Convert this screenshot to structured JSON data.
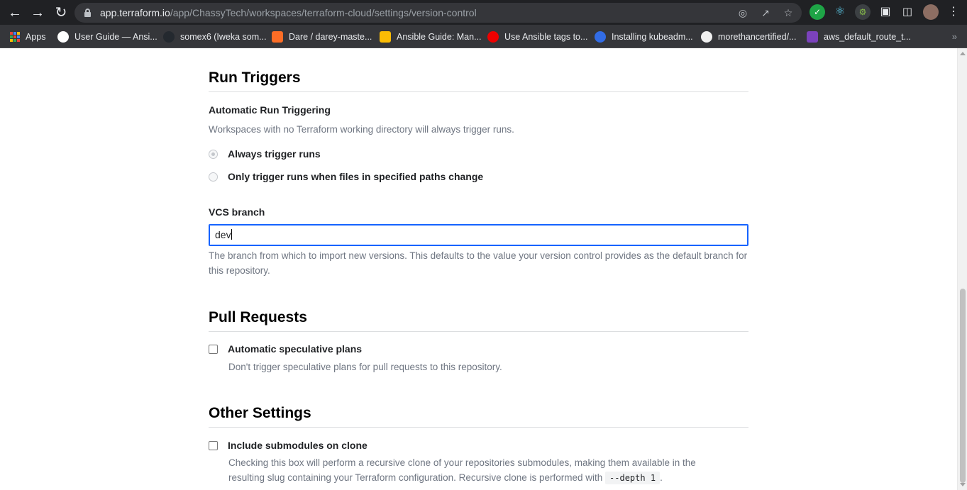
{
  "browser": {
    "url_host": "app.terraform.io",
    "url_path": "/app/ChassyTech/workspaces/terraform-cloud/settings/version-control",
    "bookmarks": [
      {
        "label": "Apps",
        "color": "#4285f4"
      },
      {
        "label": "User Guide — Ansi...",
        "color": "#ffffff"
      },
      {
        "label": "somex6 (Iweka som...",
        "color": "#24292f"
      },
      {
        "label": "Dare / darey-maste...",
        "color": "#fc6d26"
      },
      {
        "label": "Ansible Guide: Man...",
        "color": "#fbbc04"
      },
      {
        "label": "Use Ansible tags to...",
        "color": "#ee0000"
      },
      {
        "label": "Installing kubeadm...",
        "color": "#326ce5"
      },
      {
        "label": "morethancertified/...",
        "color": "#24292f"
      },
      {
        "label": "aws_default_route_t...",
        "color": "#7b42bc"
      }
    ],
    "more": "»"
  },
  "run_triggers": {
    "title": "Run Triggers",
    "auto_label": "Automatic Run Triggering",
    "auto_help": "Workspaces with no Terraform working directory will always trigger runs.",
    "option_always": "Always trigger runs",
    "option_paths": "Only trigger runs when files in specified paths change"
  },
  "vcs_branch": {
    "label": "VCS branch",
    "value": "dev",
    "help": "The branch from which to import new versions. This defaults to the value your version control provides as the default branch for this repository."
  },
  "pull_requests": {
    "title": "Pull Requests",
    "spec_label": "Automatic speculative plans",
    "spec_help": "Don't trigger speculative plans for pull requests to this repository."
  },
  "other_settings": {
    "title": "Other Settings",
    "submodules_label": "Include submodules on clone",
    "submodules_help_1": "Checking this box will perform a recursive clone of your repositories submodules, making them available in the",
    "submodules_help_2": "resulting slug containing your Terraform configuration. Recursive clone is performed with",
    "submodules_code": "--depth 1",
    "submodules_help_end": "."
  }
}
